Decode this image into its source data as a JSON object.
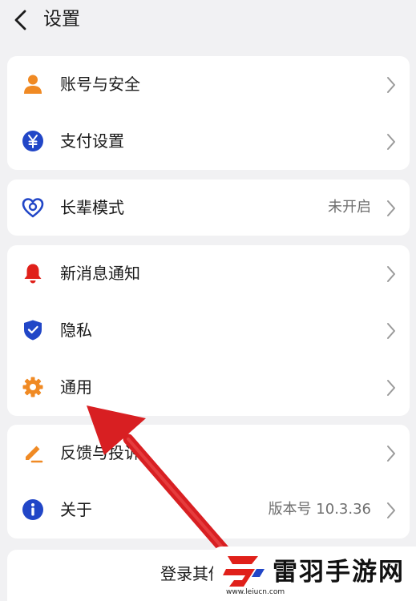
{
  "header": {
    "title": "设置"
  },
  "groups": [
    {
      "items": [
        {
          "label": "账号与安全",
          "icon": "person-icon"
        },
        {
          "label": "支付设置",
          "icon": "yen-icon"
        }
      ]
    },
    {
      "items": [
        {
          "label": "长辈模式",
          "value": "未开启",
          "icon": "heart-icon"
        }
      ]
    },
    {
      "items": [
        {
          "label": "新消息通知",
          "icon": "bell-icon"
        },
        {
          "label": "隐私",
          "icon": "shield-icon"
        },
        {
          "label": "通用",
          "icon": "gear-icon"
        }
      ]
    },
    {
      "items": [
        {
          "label": "反馈与投诉",
          "icon": "edit-icon"
        },
        {
          "label": "关于",
          "value": "版本号 10.3.36",
          "icon": "info-icon"
        }
      ]
    }
  ],
  "bottom": {
    "label": "登录其他账号"
  },
  "watermark": {
    "name": "雷羽手游网",
    "url": "www.leiucn.com"
  },
  "colors": {
    "background": "#f1f1f3",
    "card": "#ffffff",
    "orange": "#f08a24",
    "blue": "#2146c7",
    "red": "#e0201a",
    "arrow": "#d81f22"
  }
}
